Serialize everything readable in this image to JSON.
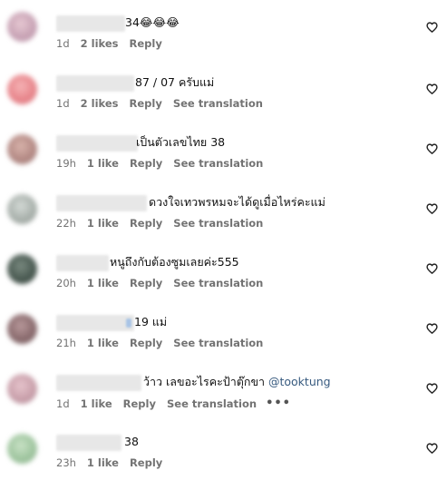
{
  "colors": {
    "meta_text": "#737373",
    "mention": "#375a7f",
    "background": "#ffffff",
    "avatar_palette": [
      "#c8a3b5",
      "#e8868c",
      "#b48a85",
      "#a9b1ac",
      "#4a5a52",
      "#8a6b6e",
      "#c9a0ab",
      "#9fc59f"
    ]
  },
  "icons": {
    "like": "heart-outline-icon",
    "more": "more-horizontal-icon"
  },
  "comments": [
    {
      "text": "34😂😂😂",
      "mention": "",
      "time": "1d",
      "likes": "2 likes",
      "reply": "Reply",
      "translation": "",
      "more": ""
    },
    {
      "text": "87 / 07 ครับแม่",
      "mention": "",
      "time": "1d",
      "likes": "2 likes",
      "reply": "Reply",
      "translation": "See translation",
      "more": ""
    },
    {
      "text": "เป็นตัวเลขไทย 38",
      "mention": "",
      "time": "19h",
      "likes": "1 like",
      "reply": "Reply",
      "translation": "See translation",
      "more": ""
    },
    {
      "text": "ดวงใจเทวพรหมจะได้ดูเมื่อไหร่คะแม่",
      "mention": "",
      "time": "22h",
      "likes": "1 like",
      "reply": "Reply",
      "translation": "See translation",
      "more": ""
    },
    {
      "text": "หนูถึงกับต้องซูมเลยค่ะ555",
      "mention": "",
      "time": "20h",
      "likes": "1 like",
      "reply": "Reply",
      "translation": "See translation",
      "more": ""
    },
    {
      "text": "19 แม่",
      "mention": "",
      "time": "21h",
      "likes": "1 like",
      "reply": "Reply",
      "translation": "See translation",
      "more": ""
    },
    {
      "text": "ว้าว เลขอะไรคะป้าตุ๊กขา ",
      "mention": "@tooktung",
      "time": "1d",
      "likes": "1 like",
      "reply": "Reply",
      "translation": "See translation",
      "more": "•••"
    },
    {
      "text": "38",
      "mention": "",
      "time": "23h",
      "likes": "1 like",
      "reply": "Reply",
      "translation": "",
      "more": ""
    }
  ]
}
